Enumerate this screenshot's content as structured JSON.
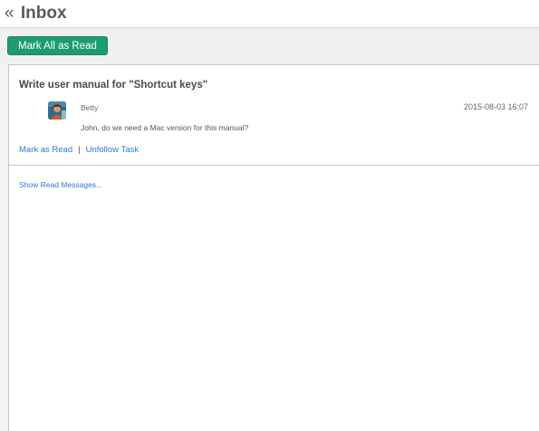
{
  "header": {
    "back_icon": "«",
    "title": "Inbox"
  },
  "toolbar": {
    "mark_all_label": "Mark All as Read",
    "accent_color": "#1d9b74"
  },
  "messages": [
    {
      "task_title": "Write user manual for \"Shortcut keys\"",
      "author": "Betty",
      "avatar_icon": "user-avatar",
      "timestamp": "2015-08-03 16:07",
      "text": "John, do we need a Mac version for this manual?",
      "actions": {
        "mark_read": "Mark as Read",
        "separator": "|",
        "unfollow": "Unfollow Task"
      }
    }
  ],
  "footer": {
    "show_read": "Show Read Messages..."
  },
  "colors": {
    "link": "#2a7ad2",
    "text": "#4a4a4a",
    "background": "#f3f3f3"
  }
}
